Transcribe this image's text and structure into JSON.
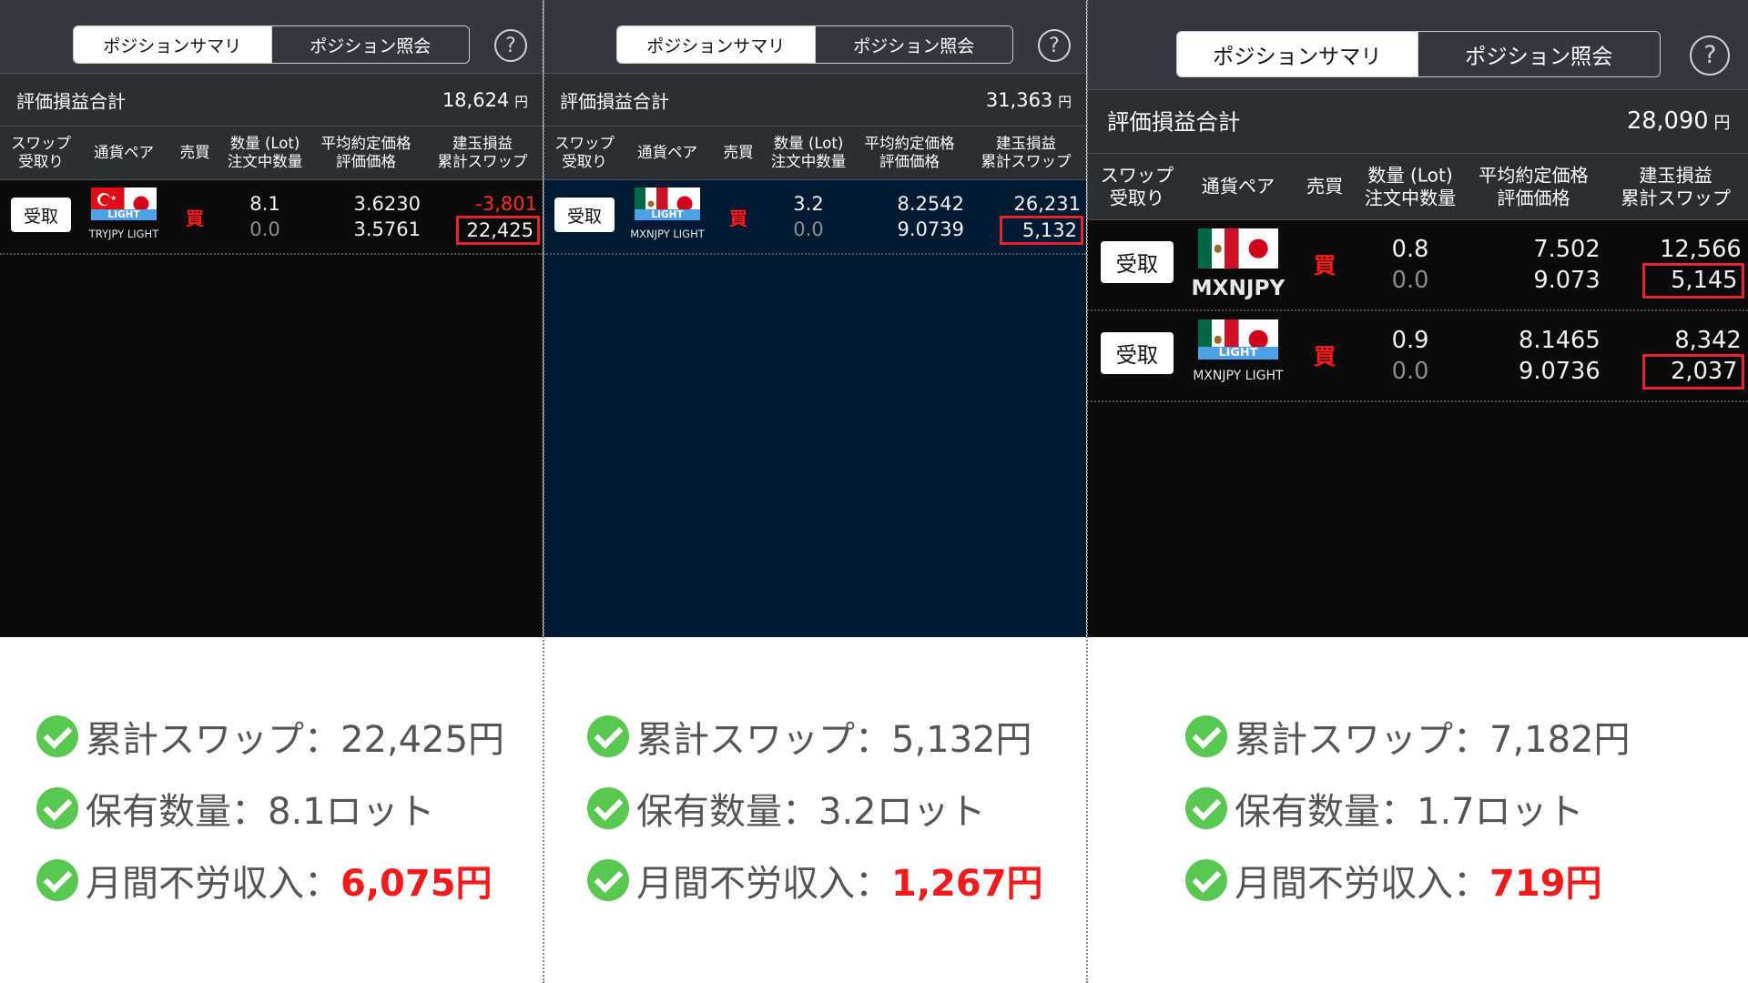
{
  "common": {
    "tab_summary": "ポジションサマリ",
    "tab_inquiry": "ポジション照会",
    "help": "?",
    "total_label": "評価損益合計",
    "yen_unit": "円",
    "headers": {
      "swap": "スワップ",
      "swap2": "受取り",
      "pair": "通貨ペア",
      "side": "売買",
      "qty": "数量 (Lot)",
      "qty2": "注文中数量",
      "avg": "平均約定価格",
      "avg2": "評価価格",
      "pl": "建玉損益",
      "pl2": "累計スワップ"
    },
    "receive_button": "受取",
    "buy_label": "買",
    "light_badge": "LIGHT"
  },
  "panels": [
    {
      "total_value": "18,624",
      "rows": [
        {
          "pair": "TRYJPY LIGHT",
          "flag": "tr",
          "light": true,
          "qty": "8.1",
          "qty_pending": "0.0",
          "avg_price": "3.6230",
          "eval_price": "3.5761",
          "pl": "-3,801",
          "swap": "22,425"
        }
      ],
      "info": {
        "swap_line": "累計スワップ：22,425円",
        "qty_line": "保有数量：8.1ロット",
        "income_label": "月間不労収入：",
        "income_value": "6,075円"
      }
    },
    {
      "total_value": "31,363",
      "rows": [
        {
          "pair": "MXNJPY LIGHT",
          "flag": "mx",
          "light": true,
          "qty": "3.2",
          "qty_pending": "0.0",
          "avg_price": "8.2542",
          "eval_price": "9.0739",
          "pl": "26,231",
          "swap": "5,132"
        }
      ],
      "info": {
        "swap_line": "累計スワップ：5,132円",
        "qty_line": "保有数量：3.2ロット",
        "income_label": "月間不労収入：",
        "income_value": "1,267円"
      }
    },
    {
      "total_value": "28,090",
      "rows": [
        {
          "pair": "MXNJPY",
          "flag": "mx",
          "light": false,
          "qty": "0.8",
          "qty_pending": "0.0",
          "avg_price": "7.502",
          "eval_price": "9.073",
          "pl": "12,566",
          "swap": "5,145"
        },
        {
          "pair": "MXNJPY LIGHT",
          "flag": "mx",
          "light": true,
          "qty": "0.9",
          "qty_pending": "0.0",
          "avg_price": "8.1465",
          "eval_price": "9.0736",
          "pl": "8,342",
          "swap": "2,037"
        }
      ],
      "info": {
        "swap_line": "累計スワップ：7,182円",
        "qty_line": "保有数量：1.7ロット",
        "income_label": "月間不労収入：",
        "income_value": "719円"
      }
    }
  ],
  "colors": {
    "accent_red": "#f21a1a",
    "check_green": "#59c851",
    "panel2_bg": "#031a33"
  }
}
